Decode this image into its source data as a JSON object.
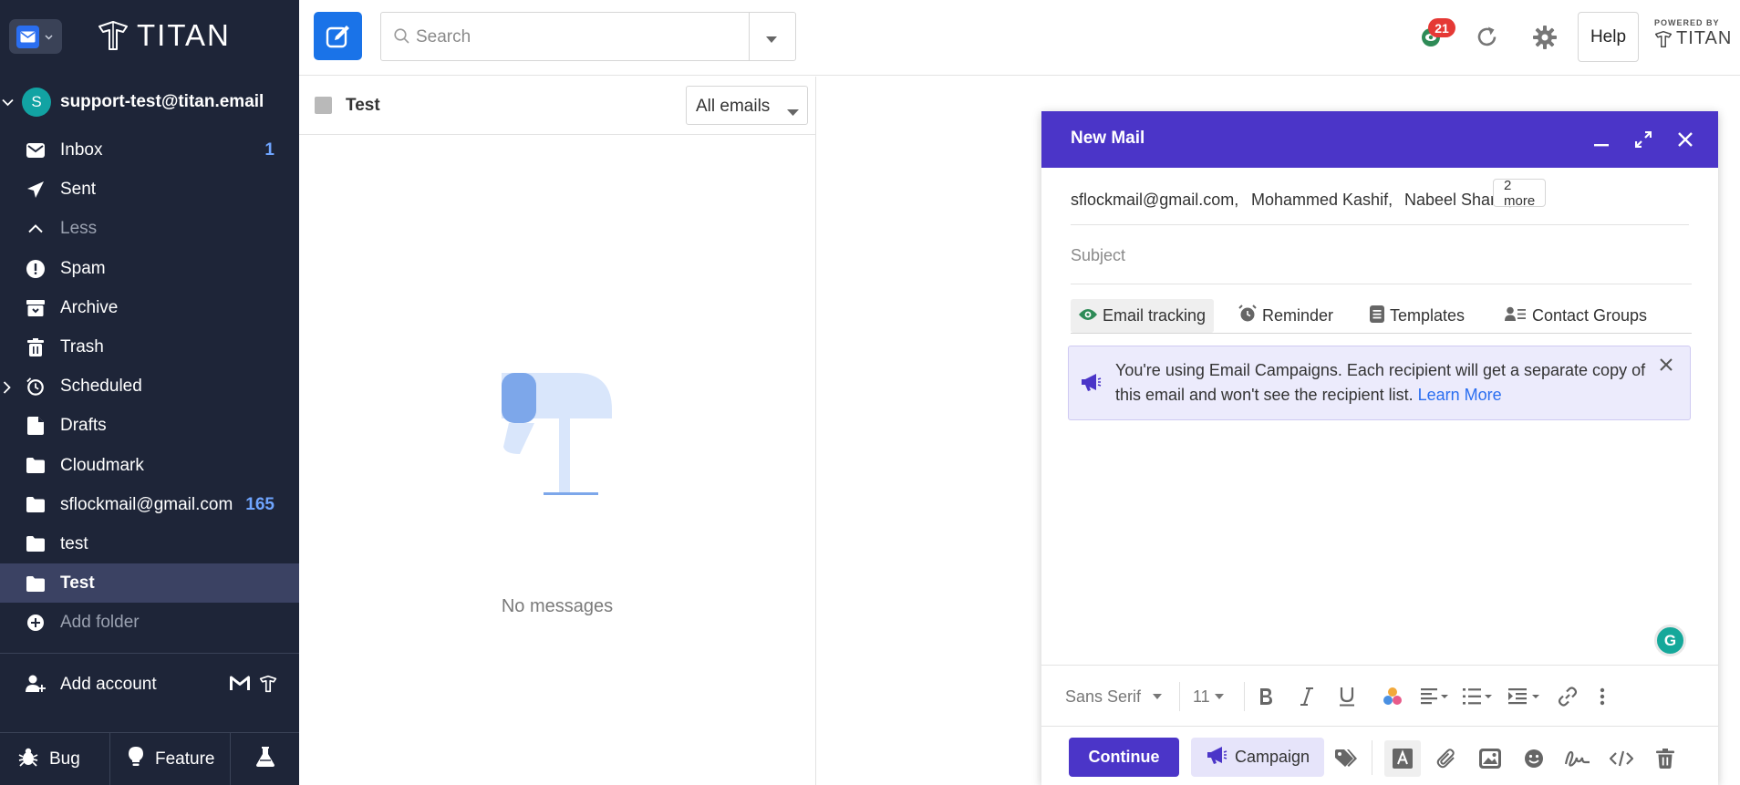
{
  "brand": {
    "name": "TITAN"
  },
  "account": {
    "initial": "S",
    "email": "support-test@titan.email"
  },
  "nav": [
    {
      "label": "Inbox",
      "count": "1",
      "icon": "inbox-icon"
    },
    {
      "label": "Sent",
      "count": "",
      "icon": "send-icon"
    },
    {
      "label": "Less",
      "count": "",
      "icon": "chevron-up-icon"
    },
    {
      "label": "Spam",
      "count": "",
      "icon": "spam-icon"
    },
    {
      "label": "Archive",
      "count": "",
      "icon": "archive-icon"
    },
    {
      "label": "Trash",
      "count": "",
      "icon": "trash-icon"
    },
    {
      "label": "Scheduled",
      "count": "",
      "icon": "clock-icon"
    },
    {
      "label": "Drafts",
      "count": "",
      "icon": "drafts-icon"
    },
    {
      "label": "Cloudmark",
      "count": "",
      "icon": "folder-icon"
    },
    {
      "label": "sflockmail@gmail.com",
      "count": "165",
      "icon": "folder-icon"
    },
    {
      "label": "test",
      "count": "",
      "icon": "folder-icon"
    },
    {
      "label": "Test",
      "count": "",
      "icon": "folder-icon"
    },
    {
      "label": "Add folder",
      "count": "",
      "icon": "plus-circle-icon"
    }
  ],
  "add_account": {
    "label": "Add account"
  },
  "bottom": {
    "bug": "Bug",
    "feature": "Feature"
  },
  "search": {
    "placeholder": "Search"
  },
  "topbar": {
    "badge": "21",
    "help": "Help",
    "powered_by": "POWERED BY",
    "powered_brand": "TITAN"
  },
  "list": {
    "title": "Test",
    "filter": "All emails",
    "empty": "No messages"
  },
  "compose": {
    "title": "New Mail",
    "recipients": [
      "sflockmail@gmail.com,",
      "Mohammed Kashif,",
      "Nabeel Shariff,"
    ],
    "more": "2 more",
    "subject_placeholder": "Subject",
    "tools": {
      "tracking": "Email tracking",
      "reminder": "Reminder",
      "templates": "Templates",
      "groups": "Contact Groups"
    },
    "notice": "You're using Email Campaigns. Each recipient will get a separate copy of this email and won't see the recipient list.",
    "learn_more": "Learn More",
    "grammarly": "G",
    "font": "Sans Serif",
    "size": "11",
    "continue": "Continue",
    "campaign": "Campaign"
  },
  "colors": {
    "sidebar": "#1e2538",
    "accent": "#4b35c8",
    "primary": "#1a73e8",
    "badge": "#e53935"
  }
}
